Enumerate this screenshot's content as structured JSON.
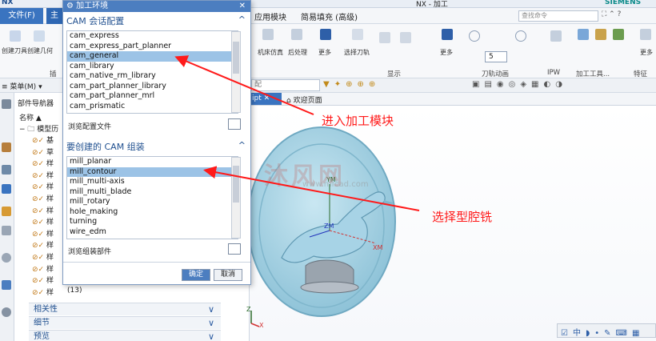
{
  "title_strip": {
    "app": "NX",
    "window_title": "NX - 加工",
    "brand": "SIEMENS"
  },
  "menu": {
    "file": "文件(F)",
    "home": "主",
    "items": [
      "应用模块",
      "简易填充 (高级)"
    ],
    "search_placeholder": "查找命令"
  },
  "ribbon": {
    "left_labels": [
      "创建刀具",
      "创建几何"
    ],
    "insert_group": "插",
    "labels": [
      "机床仿真",
      "后处理",
      "选择刀轨",
      "更多",
      "更多",
      "更多"
    ],
    "groups": [
      "显示",
      "刀轨动画",
      "IPW",
      "加工工具...",
      "特征"
    ],
    "anim_value": "5"
  },
  "toolbar2": {
    "menu": "菜单(M)",
    "filter_fragment": "配"
  },
  "tabs": {
    "part_tab": "ipt",
    "welcome": "欢迎页面"
  },
  "navigator": {
    "title": "部件导航器",
    "col_name": "名称",
    "tree_root": "模型历",
    "rows": [
      "基",
      "草",
      "样",
      "样",
      "样",
      "样",
      "样",
      "样",
      "样",
      "样",
      "样",
      "样",
      "样",
      "样"
    ],
    "last_row_suffix": "(13)",
    "sections": [
      "相关性",
      "细节",
      "预览"
    ]
  },
  "dialog": {
    "title": "加工环境",
    "config_section": "CAM 会话配置",
    "config_items": [
      "cam_express",
      "cam_express_part_planner",
      "cam_general",
      "cam_library",
      "cam_native_rm_library",
      "cam_part_planner_library",
      "cam_part_planner_mrl",
      "cam_prismatic"
    ],
    "config_selected": 2,
    "browse_config": "浏览配置文件",
    "setup_section": "要创建的 CAM 组装",
    "setup_items": [
      "mill_planar",
      "mill_contour",
      "mill_multi-axis",
      "mill_multi_blade",
      "mill_rotary",
      "hole_making",
      "turning",
      "wire_edm"
    ],
    "setup_selected": 1,
    "browse_setup": "浏览组装部件",
    "ok": "确定",
    "cancel": "取消"
  },
  "annotations": {
    "enter_module": "进入加工模块",
    "select_cavity": "选择型腔铣"
  },
  "watermark": {
    "text": "沐风网",
    "url": "www.mfcad.com"
  },
  "axes": {
    "zm": "ZM",
    "xm": "XM",
    "ym": "YM",
    "z": "Z",
    "x": "X"
  },
  "colors": {
    "accent": "#3a74c0",
    "annotation": "#ff1a1a",
    "part": "#a7d3e6",
    "selection": "#9cc3e6"
  }
}
